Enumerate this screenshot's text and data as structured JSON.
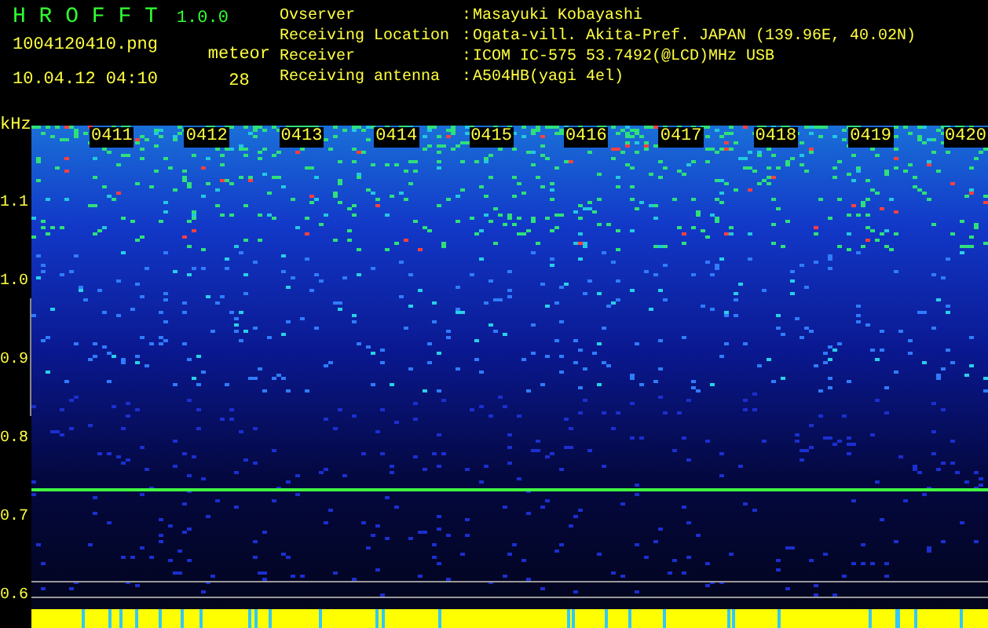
{
  "app": {
    "title": "H R O F F T",
    "version": "1.0.0",
    "file": "1004120410.png",
    "datetime": "10.04.12 04:10",
    "counter_label": "meteor",
    "counter_value": "28"
  },
  "info_separator": ":",
  "info": [
    {
      "label": "Ovserver",
      "value": "Masayuki Kobayashi"
    },
    {
      "label": "Receiving Location",
      "value": "Ogata-vill. Akita-Pref. JAPAN (139.96E, 40.02N)"
    },
    {
      "label": "Receiver",
      "value": "ICOM IC-575 53.7492(@LCD)MHz USB"
    },
    {
      "label": "Receiving antenna",
      "value": "A504HB(yagi 4el)"
    }
  ],
  "y_axis": {
    "unit": "kHz",
    "labels": [
      "1.1",
      "1.0",
      "0.9",
      "0.8",
      "0.7",
      "0.6"
    ]
  },
  "time_labels": [
    "0411",
    "0412",
    "0413",
    "0414",
    "0415",
    "0416",
    "0417",
    "0418",
    "0419",
    "0420"
  ]
}
